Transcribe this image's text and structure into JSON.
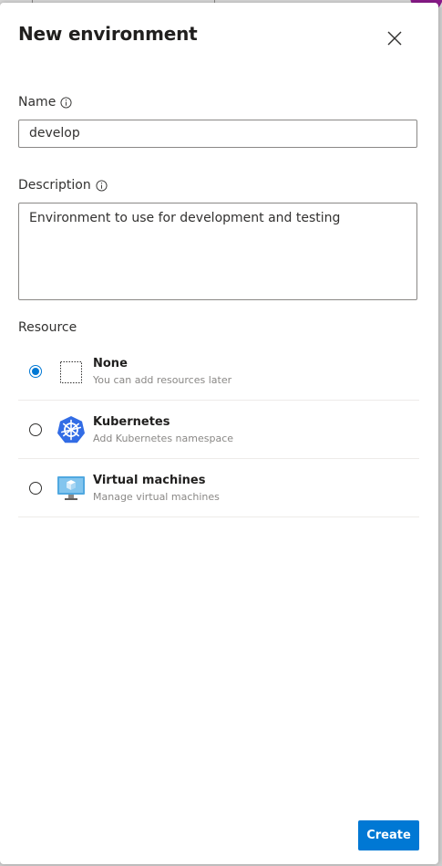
{
  "dialog": {
    "title": "New environment",
    "close_icon": "close-icon"
  },
  "name_field": {
    "label": "Name",
    "value": "develop",
    "info_icon": "info-icon"
  },
  "description_field": {
    "label": "Description",
    "value": "Environment to use for development and testing",
    "info_icon": "info-icon"
  },
  "resource": {
    "label": "Resource",
    "selected": "None",
    "options": [
      {
        "title": "None",
        "subtitle": "You can add resources later",
        "icon": "dotted-square-icon",
        "checked": true
      },
      {
        "title": "Kubernetes",
        "subtitle": "Add Kubernetes namespace",
        "icon": "kubernetes-icon",
        "checked": false
      },
      {
        "title": "Virtual machines",
        "subtitle": "Manage virtual machines",
        "icon": "virtual-machine-icon",
        "checked": false
      }
    ]
  },
  "footer": {
    "create_label": "Create"
  },
  "colors": {
    "accent": "#0078d4",
    "kubernetes": "#326ce5",
    "vm_screen": "#50a8e0"
  }
}
